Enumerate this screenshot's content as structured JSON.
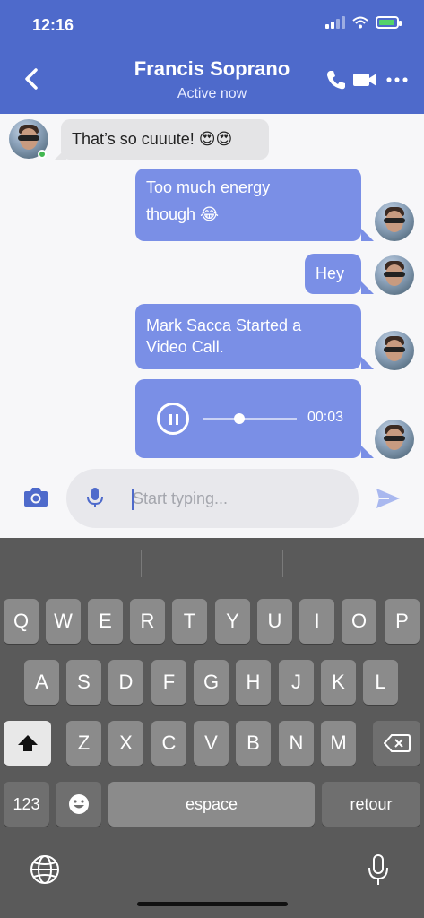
{
  "status_bar": {
    "time": "12:16"
  },
  "header": {
    "title": "Francis Soprano",
    "subtitle": "Active now",
    "icons": [
      "back-chevron-icon",
      "phone-icon",
      "video-camera-icon",
      "more-dots-icon"
    ]
  },
  "messages": [
    {
      "direction": "in",
      "text": "That’s so cuuute! 😍😍"
    },
    {
      "direction": "out",
      "lines": [
        "Too much energy",
        "though 😂"
      ]
    },
    {
      "direction": "out",
      "text": "Hey"
    },
    {
      "direction": "out",
      "lines": [
        "Mark Sacca Started a",
        "Video Call."
      ]
    },
    {
      "direction": "out",
      "type": "audio",
      "duration": "00:03",
      "progress": 0.38
    }
  ],
  "composer": {
    "placeholder": "Start typing...",
    "value": ""
  },
  "keyboard": {
    "row1": [
      "Q",
      "W",
      "E",
      "R",
      "T",
      "Y",
      "U",
      "I",
      "O",
      "P"
    ],
    "row2": [
      "A",
      "S",
      "D",
      "F",
      "G",
      "H",
      "J",
      "K",
      "L"
    ],
    "row3": [
      "Z",
      "X",
      "C",
      "V",
      "B",
      "N",
      "M"
    ],
    "numbers_label": "123",
    "space_label": "espace",
    "return_label": "retour"
  },
  "colors": {
    "header": "#4e6acb",
    "outgoing_bubble": "#7a8fe6",
    "incoming_bubble": "#e4e4e6",
    "online": "#43b851",
    "keyboard_bg": "#5a5a5a"
  }
}
